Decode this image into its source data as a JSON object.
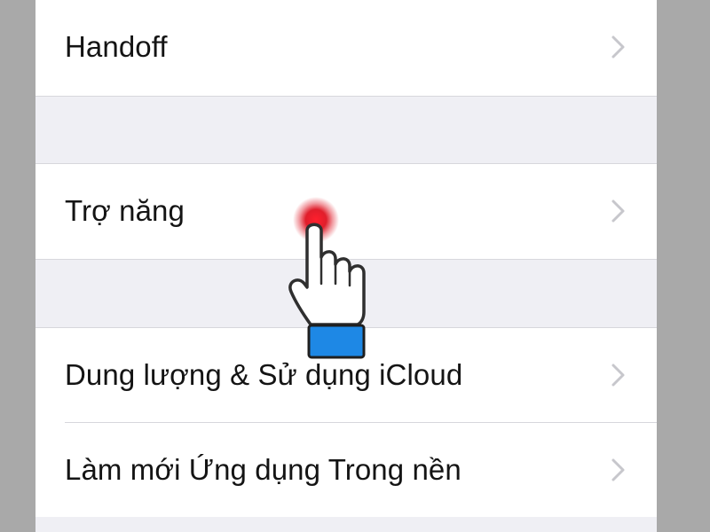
{
  "settings": {
    "rows": [
      {
        "label": "Handoff"
      },
      {
        "label": "Trợ năng"
      },
      {
        "label": "Dung lượng & Sử dụng iCloud"
      },
      {
        "label": "Làm mới Ứng dụng Trong nền"
      }
    ]
  },
  "icons": {
    "chevron": "chevron-right-icon",
    "tap_hand": "tap-hand-pointer-icon"
  },
  "colors": {
    "background": "#a9a9a9",
    "screen": "#efeff4",
    "cell": "#ffffff",
    "separator": "#d7d7dc",
    "chevron": "#c7c7cc",
    "tap_dot": "#e01e2b",
    "hand_cuff": "#1e88e5"
  }
}
